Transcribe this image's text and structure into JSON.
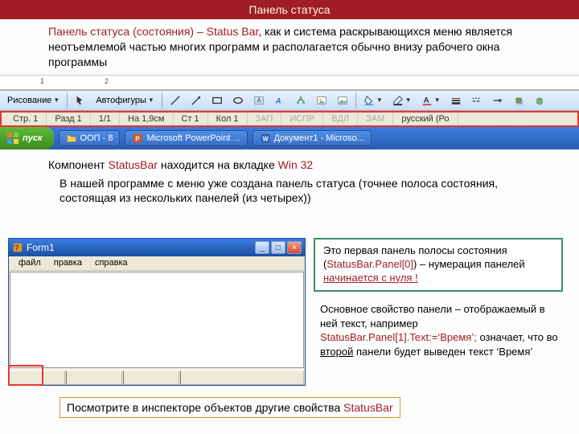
{
  "title": "Панель статуса",
  "intro": {
    "lead_red": "Панель статуса (состояния) – Status Bar",
    "rest": ", как и система раскрывающихся меню является неотъемлемой частью многих программ и располагается обычно внизу рабочего окна программы"
  },
  "word_screenshot": {
    "ruler_marks": [
      "1",
      "2"
    ],
    "drawing_label": "Рисование",
    "autoshapes_label": "Автофигуры",
    "statusbar": {
      "page": "Стр. 1",
      "section": "Разд 1",
      "pages": "1/1",
      "at": "На 1,9см",
      "line": "Ст 1",
      "col": "Кол 1",
      "rec": "ЗАП",
      "trk": "ИСПР",
      "ext": "ВДЛ",
      "ovr": "ЗАМ",
      "lang": "русский (Ро"
    },
    "taskbar": {
      "start": "пуск",
      "items": [
        {
          "label": "ООП - 8"
        },
        {
          "label": "Microsoft PowerPoint ..."
        },
        {
          "label": "Документ1 - Microso..."
        }
      ]
    }
  },
  "mid_text": {
    "line1_a": "Компонент ",
    "line1_b": "StatusBar",
    "line1_c": " находится на вкладке ",
    "line1_d": "Win 32",
    "line2": "В нашей программе с меню уже создана панель статуса (точнее полоса состояния, состоящая из нескольких панелей (из четырех))"
  },
  "form_window": {
    "title": "Form1",
    "menu": [
      "файл",
      "правка",
      "справка"
    ]
  },
  "callout1": {
    "a": "Это первая панель полосы состояния (",
    "b": "StatusBar.Panel[0]",
    "c": ") – нумерация панелей ",
    "d": "начинается с нуля !"
  },
  "body2": {
    "a": "Основное свойство панели – отображаемый в ней текст, например ",
    "b": "StatusBar.Panel[1].Text:=‘Время’;",
    "c": " означает, что во ",
    "d": "второй",
    "e": " панели будет выведен текст ‘Время’"
  },
  "footer": {
    "a": "Посмотрите в инспекторе объектов  другие свойства ",
    "b": "StatusBar"
  }
}
